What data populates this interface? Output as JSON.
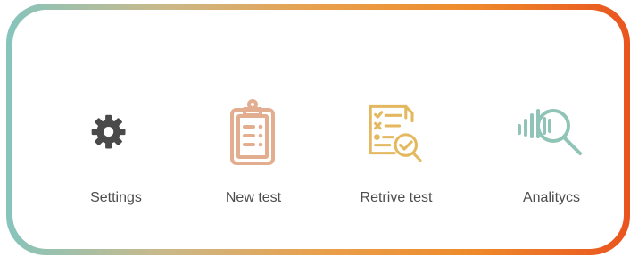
{
  "menu": {
    "items": [
      {
        "label": "Settings",
        "icon": "gear-icon",
        "color": "#4a4a4a"
      },
      {
        "label": "New test",
        "icon": "clipboard-list-icon",
        "color": "#e3ad8f"
      },
      {
        "label": "Retrive test",
        "icon": "document-search-check-icon",
        "color": "#e3b85e"
      },
      {
        "label": "Analitycs",
        "icon": "analytics-magnifier-icon",
        "color": "#8fc4b6"
      }
    ]
  },
  "frame": {
    "gradient_colors": [
      "#86c4bc",
      "#e9a04c",
      "#e9541f"
    ]
  }
}
